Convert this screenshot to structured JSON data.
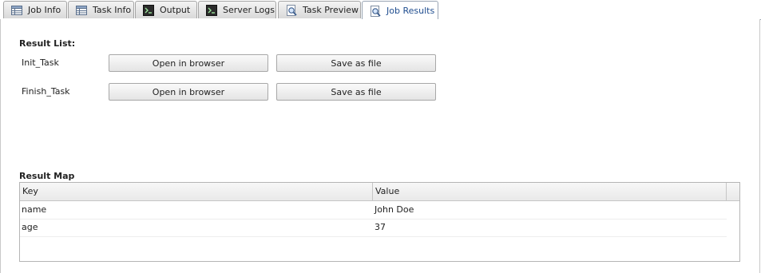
{
  "tabs": [
    {
      "label": "Job Info",
      "icon": "table-icon"
    },
    {
      "label": "Task Info",
      "icon": "table-icon"
    },
    {
      "label": "Output",
      "icon": "terminal-icon"
    },
    {
      "label": "Server Logs",
      "icon": "terminal-icon"
    },
    {
      "label": "Task Preview",
      "icon": "magnifier-icon"
    },
    {
      "label": "Job Results",
      "icon": "magnifier-icon",
      "active": true
    }
  ],
  "result_list": {
    "title": "Result List:",
    "items": [
      {
        "name": "Init_Task",
        "open_label": "Open in browser",
        "save_label": "Save as file"
      },
      {
        "name": "Finish_Task",
        "open_label": "Open in browser",
        "save_label": "Save as file"
      }
    ]
  },
  "result_map": {
    "title": "Result Map",
    "columns": [
      "Key",
      "Value"
    ],
    "rows": [
      [
        "name",
        "John Doe"
      ],
      [
        "age",
        "37"
      ]
    ]
  },
  "colors": {
    "active_tab_text": "#1f4d8f",
    "border": "#b5b5b5"
  }
}
